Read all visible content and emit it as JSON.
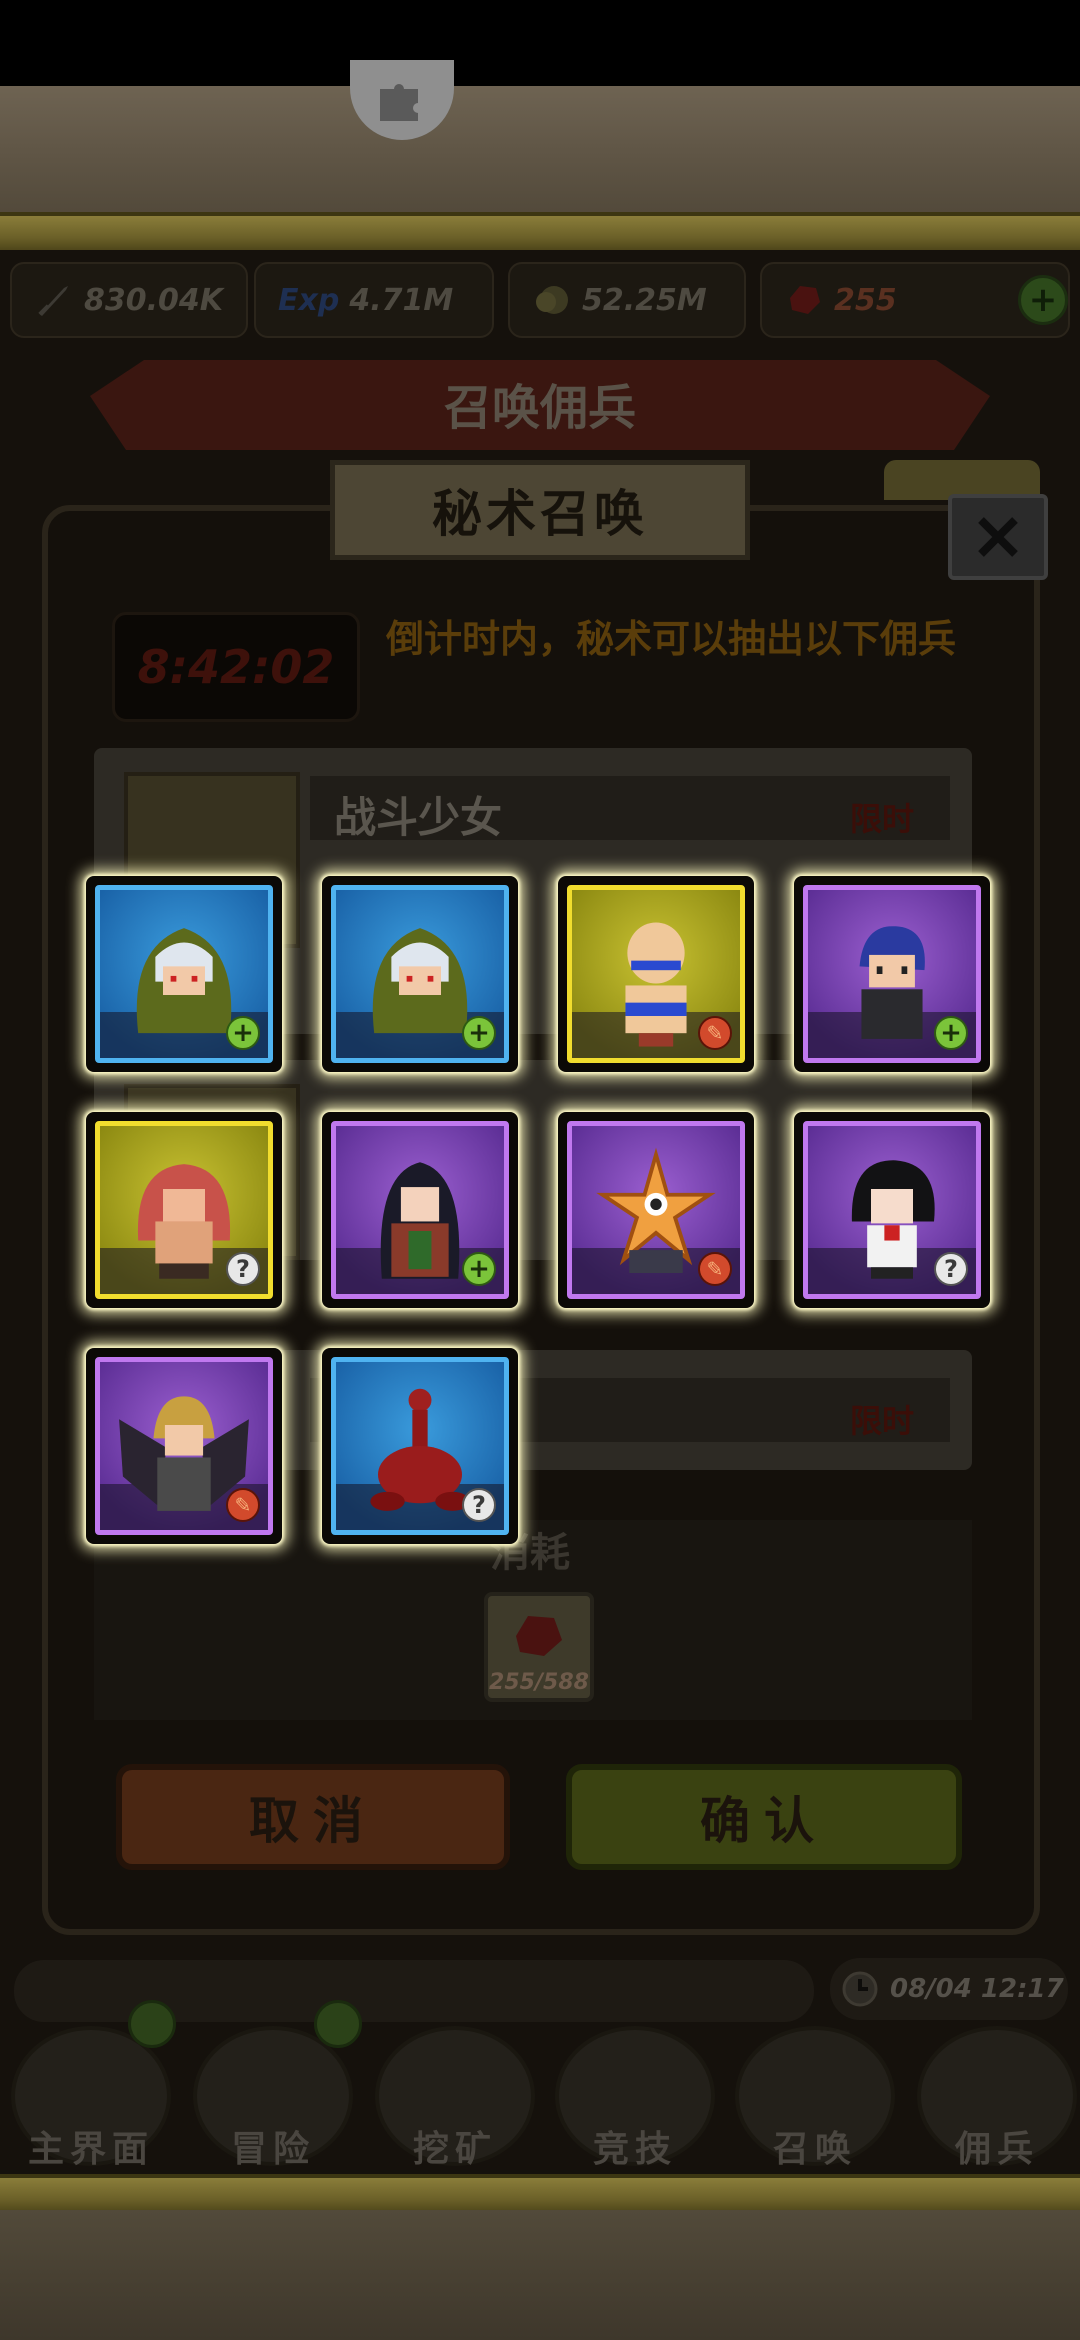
{
  "resources": [
    {
      "icon": "sword-icon",
      "value": "830.04K"
    },
    {
      "icon": "exp-icon",
      "value": "4.71M"
    },
    {
      "icon": "gold-coin-icon",
      "value": "52.25M"
    },
    {
      "icon": "ruby-icon",
      "value": "255"
    }
  ],
  "resources_plus": "+",
  "exp_text": "Exp",
  "summon_header": "召唤佣兵",
  "popup": {
    "title": "秘术召唤",
    "timer": "8:42:02",
    "countdown_text": "倒计时内，秘术可以抽出以下佣兵",
    "rows": [
      {
        "name": "战斗少女",
        "limited": "限时"
      },
      {
        "name": "",
        "limited": "限时"
      }
    ],
    "consume_label": "消耗",
    "cost": "255/588",
    "cancel": "取消",
    "confirm": "确认"
  },
  "heroes": [
    {
      "rarity": "blue",
      "badge": "plus",
      "character": "green-hood-silver-hair"
    },
    {
      "rarity": "blue",
      "badge": "plus",
      "character": "green-hood-silver-hair"
    },
    {
      "rarity": "gold",
      "badge": "feather",
      "character": "bald-fighter"
    },
    {
      "rarity": "purple",
      "badge": "plus",
      "character": "blue-hair-boy"
    },
    {
      "rarity": "gold",
      "badge": "question",
      "character": "red-hair-brawler"
    },
    {
      "rarity": "purple",
      "badge": "plus",
      "character": "dark-hair-mage"
    },
    {
      "rarity": "purple",
      "badge": "feather",
      "character": "starfish"
    },
    {
      "rarity": "purple",
      "badge": "question",
      "character": "black-hair-girl"
    },
    {
      "rarity": "purple",
      "badge": "feather",
      "character": "winged-knight"
    },
    {
      "rarity": "blue",
      "badge": "question",
      "character": "red-scorpion"
    }
  ],
  "badge_glyphs": {
    "plus": "+",
    "question": "?",
    "feather": "✎"
  },
  "date": "08/04 12:17",
  "nav": [
    {
      "label": "主界面",
      "icon": "map-scroll-icon"
    },
    {
      "label": "冒险",
      "icon": "adventure-icon"
    },
    {
      "label": "挖矿",
      "icon": "pickaxe-icon"
    },
    {
      "label": "竞技",
      "icon": "crossed-swords-icon"
    },
    {
      "label": "召唤",
      "icon": "summon-scroll-icon"
    },
    {
      "label": "佣兵",
      "icon": "tent-icon"
    }
  ],
  "colors": {
    "glow": "#fffbd8",
    "blue_frame": "#4fb3f0",
    "gold_frame": "#f1dd2e",
    "purple_frame": "#c078ef"
  }
}
